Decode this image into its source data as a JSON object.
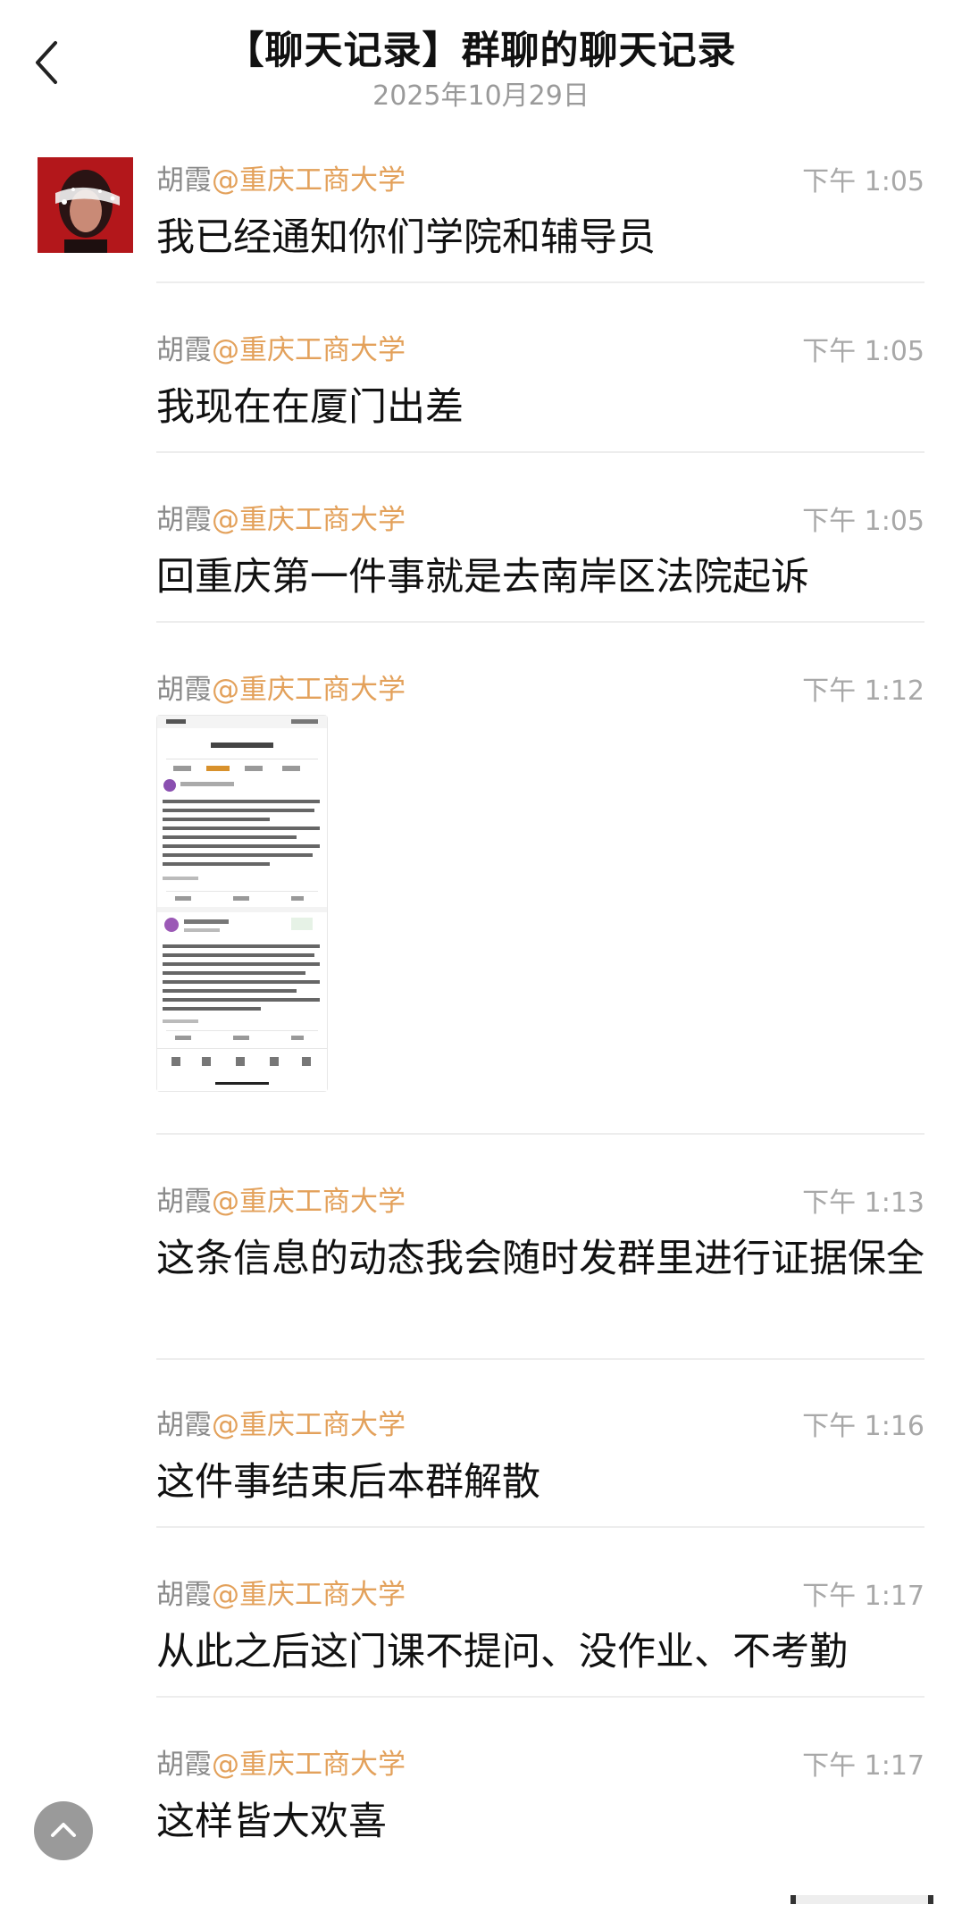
{
  "header": {
    "title": "【聊天记录】群聊的聊天记录",
    "date": "2025年10月29日"
  },
  "messages": [
    {
      "sender": "胡霞",
      "org": "@重庆工商大学",
      "time": "下午 1:05",
      "text": "我已经通知你们学院和辅导员"
    },
    {
      "sender": "胡霞",
      "org": "@重庆工商大学",
      "time": "下午 1:05",
      "text": "我现在在厦门出差"
    },
    {
      "sender": "胡霞",
      "org": "@重庆工商大学",
      "time": "下午 1:05",
      "text": "回重庆第一件事就是去南岸区法院起诉"
    },
    {
      "sender": "胡霞",
      "org": "@重庆工商大学",
      "time": "下午 1:12",
      "text": ""
    },
    {
      "sender": "胡霞",
      "org": "@重庆工商大学",
      "time": "下午 1:13",
      "text": "这条信息的动态我会随时发群里进行证据保全"
    },
    {
      "sender": "胡霞",
      "org": "@重庆工商大学",
      "time": "下午 1:16",
      "text": "这件事结束后本群解散"
    },
    {
      "sender": "胡霞",
      "org": "@重庆工商大学",
      "time": "下午 1:17",
      "text": "从此之后这门课不提问、没作业、不考勤"
    },
    {
      "sender": "胡霞",
      "org": "@重庆工商大学",
      "time": "下午 1:17",
      "text": "这样皆大欢喜"
    }
  ],
  "colors": {
    "accent": "#e3a15b",
    "sender": "#8a8a8a",
    "time": "#a8a8a8",
    "divider": "#ededed",
    "avatar_bg": "#b3171b"
  },
  "icons": {
    "back": "chevron-left-icon",
    "scroll_top": "chevron-up-icon"
  }
}
